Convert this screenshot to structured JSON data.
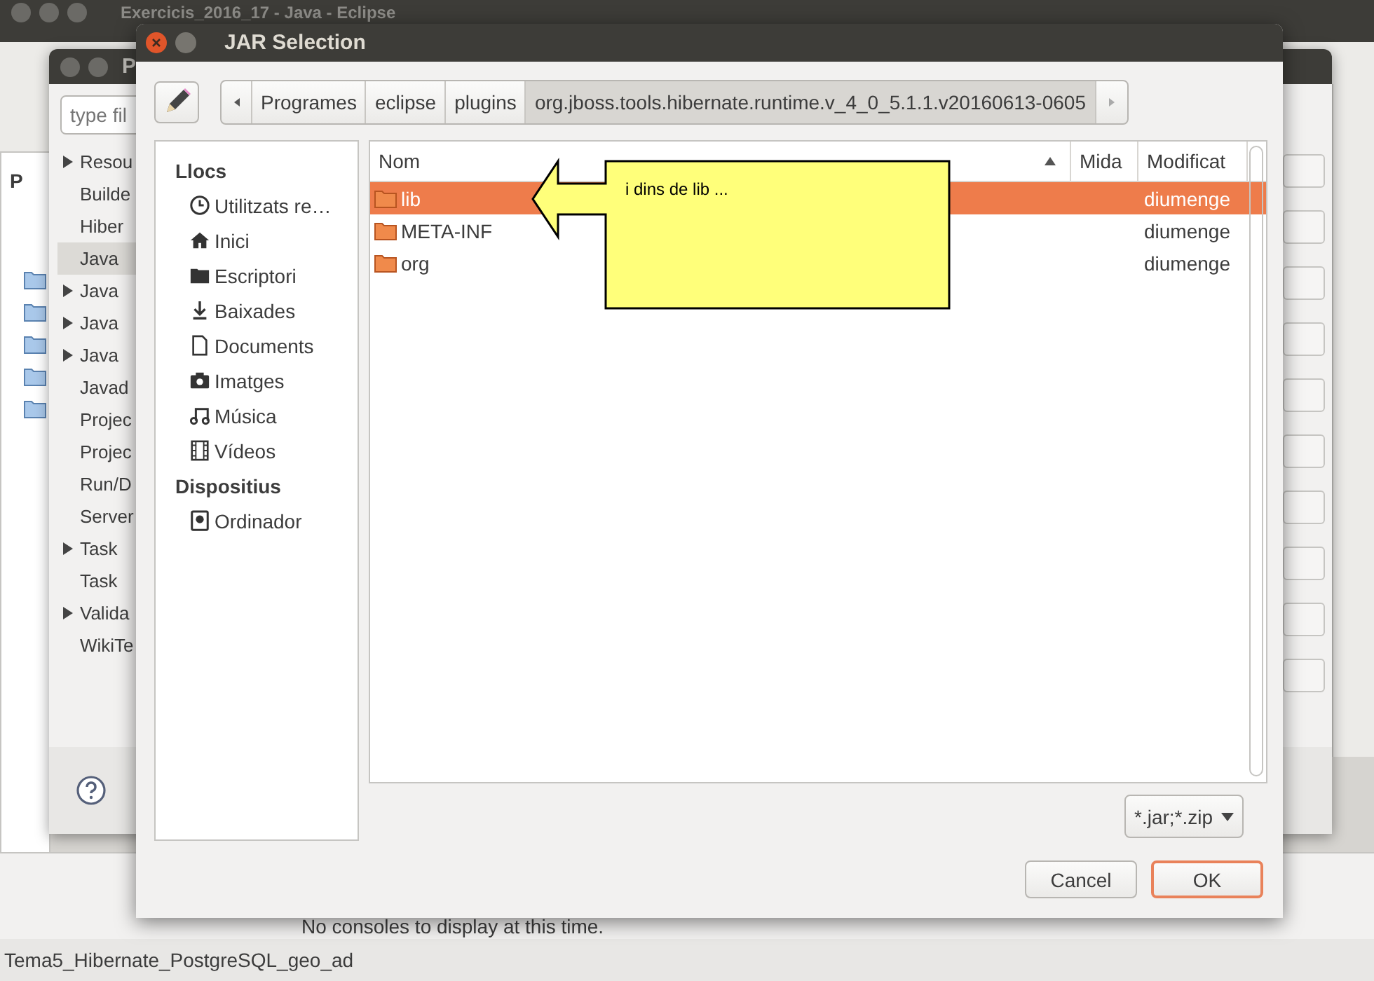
{
  "eclipse_window": {
    "title": "Exercicis_2016_17 - Java - Eclipse",
    "explorer_tab": "P"
  },
  "preferences_dialog": {
    "title": "P",
    "filter_placeholder": "type fil",
    "items": [
      {
        "label": "Resou",
        "expandable": true,
        "selected": false
      },
      {
        "label": "Builde",
        "expandable": false,
        "selected": false
      },
      {
        "label": "Hiber",
        "expandable": false,
        "selected": false
      },
      {
        "label": "Java",
        "expandable": false,
        "selected": true
      },
      {
        "label": "Java",
        "expandable": true,
        "selected": false
      },
      {
        "label": "Java",
        "expandable": true,
        "selected": false
      },
      {
        "label": "Java",
        "expandable": true,
        "selected": false
      },
      {
        "label": "Javad",
        "expandable": false,
        "selected": false
      },
      {
        "label": "Projec",
        "expandable": false,
        "selected": false
      },
      {
        "label": "Projec",
        "expandable": false,
        "selected": false
      },
      {
        "label": "Run/D",
        "expandable": false,
        "selected": false
      },
      {
        "label": "Server",
        "expandable": false,
        "selected": false
      },
      {
        "label": "Task",
        "expandable": true,
        "selected": false
      },
      {
        "label": "Task",
        "expandable": false,
        "selected": false
      },
      {
        "label": "Valida",
        "expandable": true,
        "selected": false
      },
      {
        "label": "WikiTe",
        "expandable": false,
        "selected": false
      }
    ]
  },
  "console": {
    "message": "No consoles to display at this time."
  },
  "status_bar": {
    "project": "Tema5_Hibernate_PostgreSQL_geo_ad"
  },
  "jar_dialog": {
    "title": "JAR Selection",
    "path": [
      {
        "label": "Programes",
        "selected": false
      },
      {
        "label": "eclipse",
        "selected": false
      },
      {
        "label": "plugins",
        "selected": false
      },
      {
        "label": "org.jboss.tools.hibernate.runtime.v_4_0_5.1.1.v20160613-0605",
        "selected": true
      }
    ],
    "places_heading": "Llocs",
    "places": [
      {
        "label": "Utilitzats re…",
        "kind": "recent"
      },
      {
        "label": "Inici",
        "kind": "home"
      },
      {
        "label": "Escriptori",
        "kind": "desktop"
      },
      {
        "label": "Baixades",
        "kind": "downloads"
      },
      {
        "label": "Documents",
        "kind": "documents"
      },
      {
        "label": "Imatges",
        "kind": "pictures"
      },
      {
        "label": "Música",
        "kind": "music"
      },
      {
        "label": "Vídeos",
        "kind": "videos"
      }
    ],
    "devices_heading": "Dispositius",
    "devices": [
      {
        "label": "Ordinador",
        "kind": "drive"
      }
    ],
    "columns": [
      "Nom",
      "Mida",
      "Modificat"
    ],
    "rows": [
      {
        "name": "lib",
        "modified": "diumenge",
        "selected": true
      },
      {
        "name": "META-INF",
        "modified": "diumenge",
        "selected": false
      },
      {
        "name": "org",
        "modified": "diumenge",
        "selected": false
      }
    ],
    "filter": "*.jar;*.zip",
    "buttons": [
      {
        "label": "Cancel",
        "kind": "cancel"
      },
      {
        "label": "OK",
        "kind": "default"
      }
    ]
  },
  "callout": {
    "text": "i dins de lib ..."
  }
}
